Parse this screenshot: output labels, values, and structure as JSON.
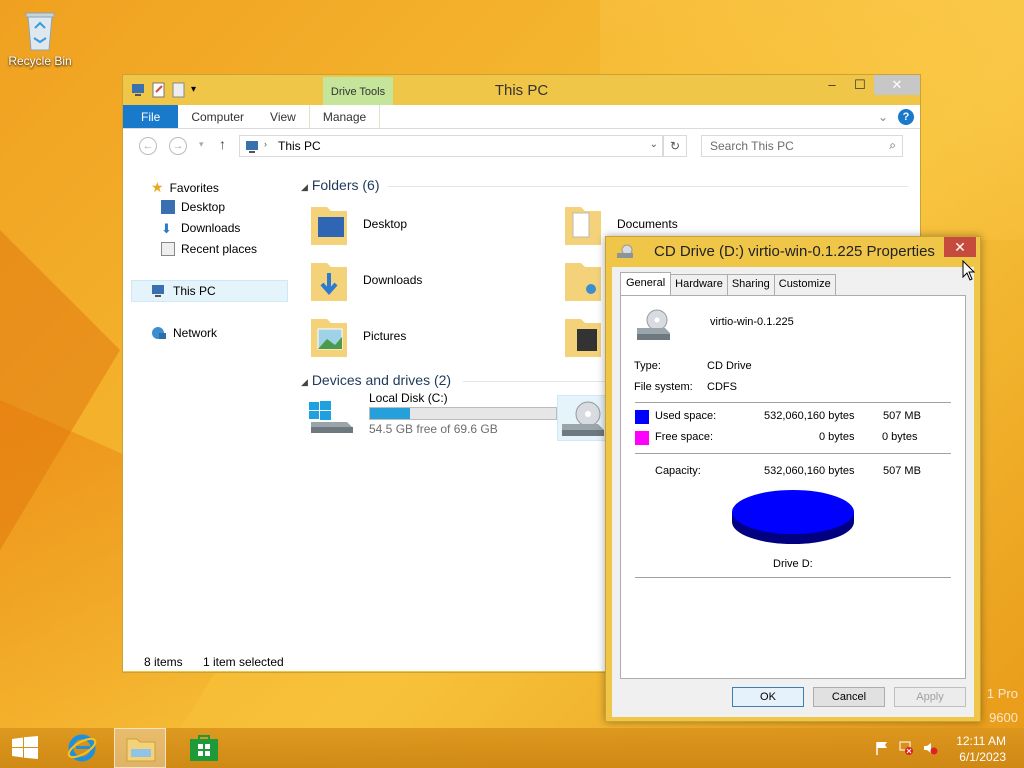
{
  "desktop": {
    "recycle_bin_label": "Recycle Bin",
    "watermark_line1": "1 Pro",
    "watermark_line2": "9600"
  },
  "explorer": {
    "title": "This PC",
    "drive_tools_label": "Drive Tools",
    "ribbon_tabs": [
      "File",
      "Computer",
      "View",
      "Manage"
    ],
    "address_path": "This PC",
    "search_placeholder": "Search This PC",
    "nav": {
      "favorites": "Favorites",
      "desktop": "Desktop",
      "downloads": "Downloads",
      "recent": "Recent places",
      "this_pc": "This PC",
      "network": "Network"
    },
    "folders_header": "Folders (6)",
    "folders": [
      "Desktop",
      "Documents",
      "Downloads",
      "Pictures"
    ],
    "devices_header": "Devices and drives (2)",
    "local_disk": {
      "name": "Local Disk (C:)",
      "free_text": "54.5 GB free of 69.6 GB",
      "used_fraction": 0.217
    },
    "status": {
      "items": "8 items",
      "selected": "1 item selected"
    }
  },
  "properties": {
    "title": "CD Drive (D:) virtio-win-0.1.225 Properties",
    "tabs": [
      "General",
      "Hardware",
      "Sharing",
      "Customize"
    ],
    "volume_label": "virtio-win-0.1.225",
    "type_label": "Type:",
    "type_value": "CD Drive",
    "fs_label": "File system:",
    "fs_value": "CDFS",
    "used_label": "Used space:",
    "used_bytes": "532,060,160 bytes",
    "used_mb": "507 MB",
    "free_label": "Free space:",
    "free_bytes": "0 bytes",
    "free_short": "0 bytes",
    "capacity_label": "Capacity:",
    "capacity_bytes": "532,060,160 bytes",
    "capacity_mb": "507 MB",
    "drive_caption": "Drive D:",
    "used_color": "#0000ff",
    "free_color": "#ff00ff",
    "buttons": {
      "ok": "OK",
      "cancel": "Cancel",
      "apply": "Apply"
    }
  },
  "taskbar": {
    "time": "12:11 AM",
    "date": "6/1/2023"
  }
}
